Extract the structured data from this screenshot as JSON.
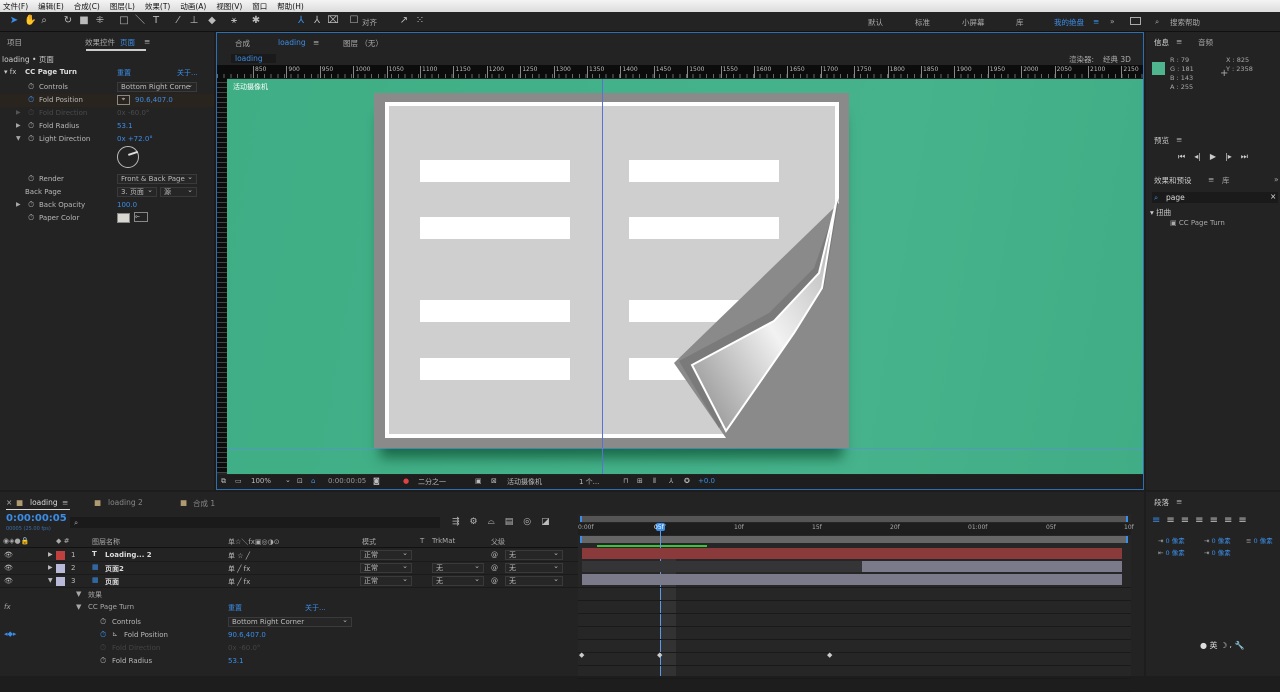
{
  "menu": [
    "文件(F)",
    "编辑(E)",
    "合成(C)",
    "图层(L)",
    "效果(T)",
    "动画(A)",
    "视图(V)",
    "窗口",
    "帮助(H)"
  ],
  "toolbar": {
    "snap_label": "对齐",
    "workspaces": [
      "默认",
      "标准",
      "小屏幕",
      "库"
    ],
    "active_workspace": "我的绝盘",
    "search_placeholder": "搜索帮助"
  },
  "left_panel": {
    "tab_project": "项目",
    "tab_effects": "效果控件",
    "tab_effects_layer": "页面",
    "breadcrumb": "loading • 页面",
    "effect": {
      "name": "CC Page Turn",
      "reset": "重置",
      "about": "关于...",
      "props": [
        {
          "label": "Controls",
          "value": "Bottom Right Corne",
          "type": "dropdown"
        },
        {
          "label": "Fold Position",
          "value": "90.6,407.0",
          "type": "point"
        },
        {
          "label": "Fold Direction",
          "value": "0x -60.0°",
          "type": "disabled"
        },
        {
          "label": "Fold Radius",
          "value": "53.1",
          "type": "value"
        },
        {
          "label": "Light Direction",
          "value": "0x +72.0°",
          "type": "angle"
        },
        {
          "label": "Render",
          "value": "Front & Back Page",
          "type": "dropdown"
        },
        {
          "label": "Back Page",
          "value": "3. 页面",
          "value2": "源",
          "type": "dropdown2"
        },
        {
          "label": "Back Opacity",
          "value": "100.0",
          "type": "value"
        },
        {
          "label": "Paper Color",
          "value": "#d8d8d0",
          "type": "color"
        }
      ]
    }
  },
  "comp": {
    "tab": "合成",
    "comp_name": "loading",
    "layer_tab": "图层 （无）",
    "subtab": "loading",
    "renderer_label": "渲染器:",
    "renderer": "经典 3D",
    "camera_label": "活动摄像机",
    "ruler": [
      850,
      900,
      950,
      1000,
      1050,
      1100,
      1150,
      1200,
      1250,
      1300,
      1350,
      1400,
      1450,
      1500,
      1550,
      1600,
      1650,
      1700,
      1750,
      1800,
      1850,
      1900,
      1950,
      2000,
      2050,
      2100,
      2150
    ],
    "bg_color": "#3fae85",
    "footer": {
      "zoom": "100%",
      "timecode": "0:00:00:05",
      "resolution": "二分之一",
      "camera": "活动摄像机",
      "views": "1 个...",
      "exposure": "+0.0"
    }
  },
  "info": {
    "tab": "信息",
    "tab2": "音频",
    "r": "R : 79",
    "g": "G : 181",
    "b": "B : 143",
    "a": "A : 255",
    "x": "X : 825",
    "y": "Y : 2358",
    "swatch": "#4fb58f"
  },
  "preview": {
    "title": "预览"
  },
  "effects_presets": {
    "tab": "效果和预设",
    "tab2": "库",
    "search": "page",
    "category": "扭曲",
    "item": "CC Page Turn"
  },
  "paragraph": {
    "title": "段落",
    "fields": [
      "0 像素",
      "0 像素",
      "0 像素",
      "0 像素",
      "0 像素"
    ]
  },
  "timeline": {
    "tabs": [
      "loading",
      "loading 2",
      "合成 1"
    ],
    "timecode": "0:00:00:05",
    "fps": "00005 (25.00 fps)",
    "headers": {
      "name": "图层名称",
      "switches": "单☆＼fx▣◎◑⊙",
      "mode": "模式",
      "t": "T",
      "trkmat": "TrkMat",
      "parent": "父级"
    },
    "layers": [
      {
        "num": "1",
        "type": "T",
        "name": "Loading... 2",
        "color": "#c04040",
        "mode": "正常",
        "trkmat": "",
        "parent": "无",
        "bar_color": "#8a3a3a"
      },
      {
        "num": "2",
        "type": "comp",
        "name": "页面2",
        "color": "#b8b8d8",
        "mode": "正常",
        "trkmat": "无",
        "parent": "无",
        "bar_color": "#7a7a8a"
      },
      {
        "num": "3",
        "type": "comp",
        "name": "页面",
        "color": "#b8b8d8",
        "mode": "正常",
        "trkmat": "无",
        "parent": "无",
        "bar_color": "#7a7a8a"
      }
    ],
    "effects_label": "效果",
    "effect": "CC Page Turn",
    "reset": "重置",
    "about": "关于...",
    "props": [
      {
        "label": "Controls",
        "value": "Bottom Right Corner"
      },
      {
        "label": "Fold Position",
        "value": "90.6,407.0"
      },
      {
        "label": "Fold Direction",
        "value": "0x -60.0°"
      },
      {
        "label": "Fold Radius",
        "value": "53.1"
      }
    ],
    "ruler": [
      "0:00f",
      "05f",
      "10f",
      "15f",
      "20f",
      "01:00f",
      "05f",
      "10f"
    ],
    "current_frame_label": "05f"
  }
}
